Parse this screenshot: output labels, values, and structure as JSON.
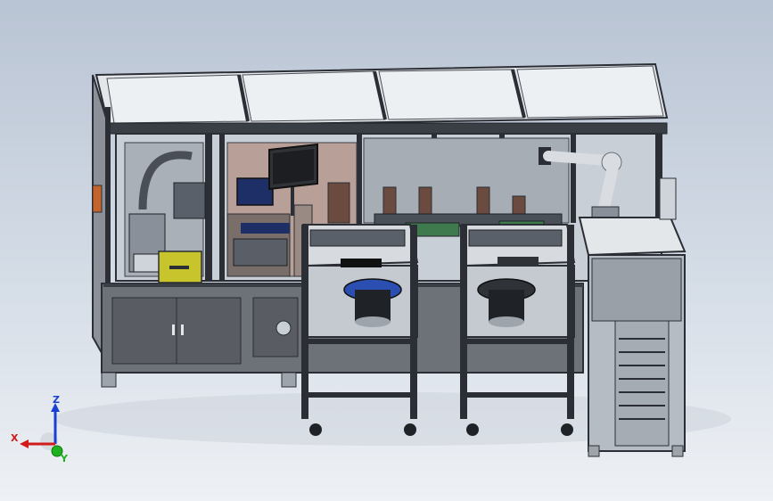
{
  "triad": {
    "x_label": "X",
    "y_label": "Y",
    "z_label": "Z",
    "colors": {
      "x": "#d11a1a",
      "y": "#1fb01f",
      "z": "#1a3fd1"
    }
  },
  "colors": {
    "background_top": "#b9c4d4",
    "background_bottom": "#eef1f5",
    "frame": "#2b2f35",
    "panel": "#6d7178",
    "glass": "#c9cfd6",
    "roof": "#e4e7ea",
    "robot": "#d9dde2",
    "drawer": "#c8c42c",
    "bowl": "#2b4fb0",
    "screen": "#1d2f66"
  }
}
